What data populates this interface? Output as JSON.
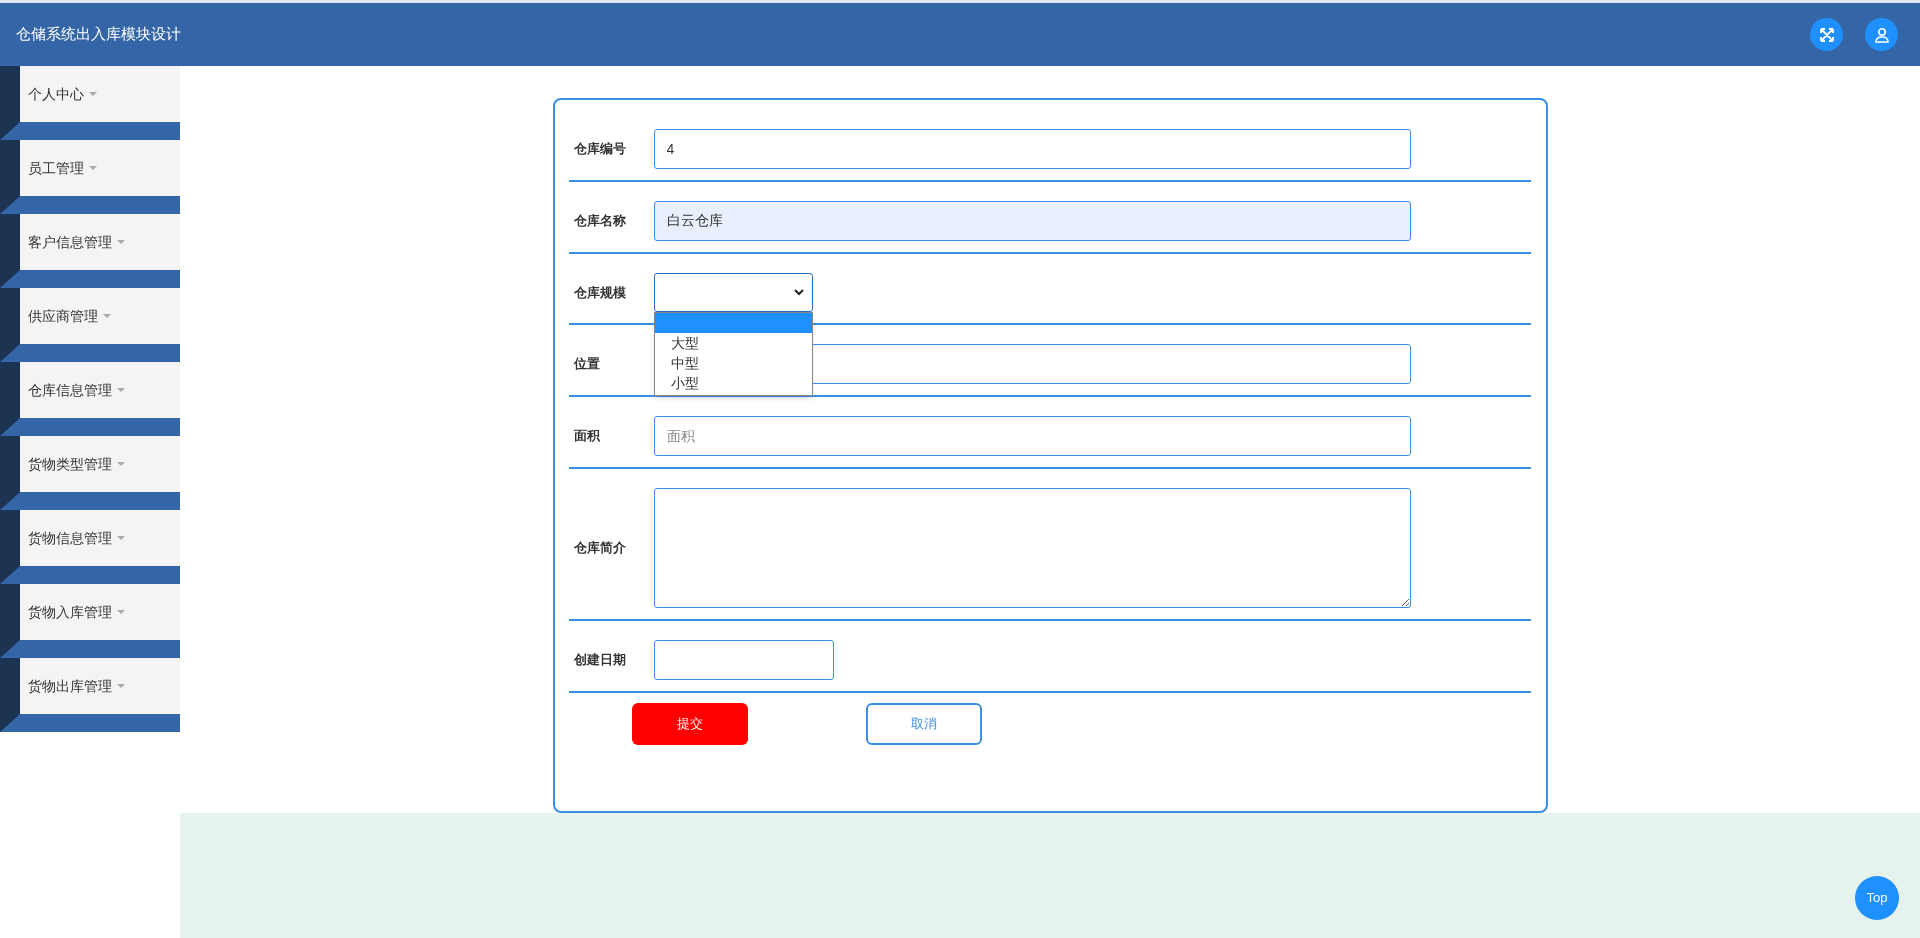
{
  "header": {
    "title": "仓储系统出入库模块设计"
  },
  "sidebar": {
    "items": [
      {
        "label": "个人中心"
      },
      {
        "label": "员工管理"
      },
      {
        "label": "客户信息管理"
      },
      {
        "label": "供应商管理"
      },
      {
        "label": "仓库信息管理"
      },
      {
        "label": "货物类型管理"
      },
      {
        "label": "货物信息管理"
      },
      {
        "label": "货物入库管理"
      },
      {
        "label": "货物出库管理"
      }
    ]
  },
  "form": {
    "fields": [
      {
        "kind": "text",
        "label": "仓库编号",
        "value": "4",
        "autofilled": false
      },
      {
        "kind": "text",
        "label": "仓库名称",
        "value": "白云仓库",
        "autofilled": true
      },
      {
        "kind": "select",
        "label": "仓库规模",
        "expanded": true,
        "options": [
          {
            "selected": true
          },
          {
            "label": "大型",
            "selected": false
          },
          {
            "label": "中型",
            "selected": false
          },
          {
            "label": "小型",
            "selected": false
          }
        ]
      },
      {
        "kind": "text",
        "label": "位置",
        "autofilled": false
      },
      {
        "kind": "text",
        "label": "面积",
        "placeholder": "面积",
        "autofilled": false
      },
      {
        "kind": "textarea",
        "label": "仓库简介"
      },
      {
        "kind": "date",
        "label": "创建日期"
      }
    ],
    "buttons": [
      {
        "kind": "primary",
        "label": "提交"
      },
      {
        "kind": "secondary",
        "label": "取消"
      }
    ]
  },
  "back_to_top": {
    "label": "Top"
  }
}
